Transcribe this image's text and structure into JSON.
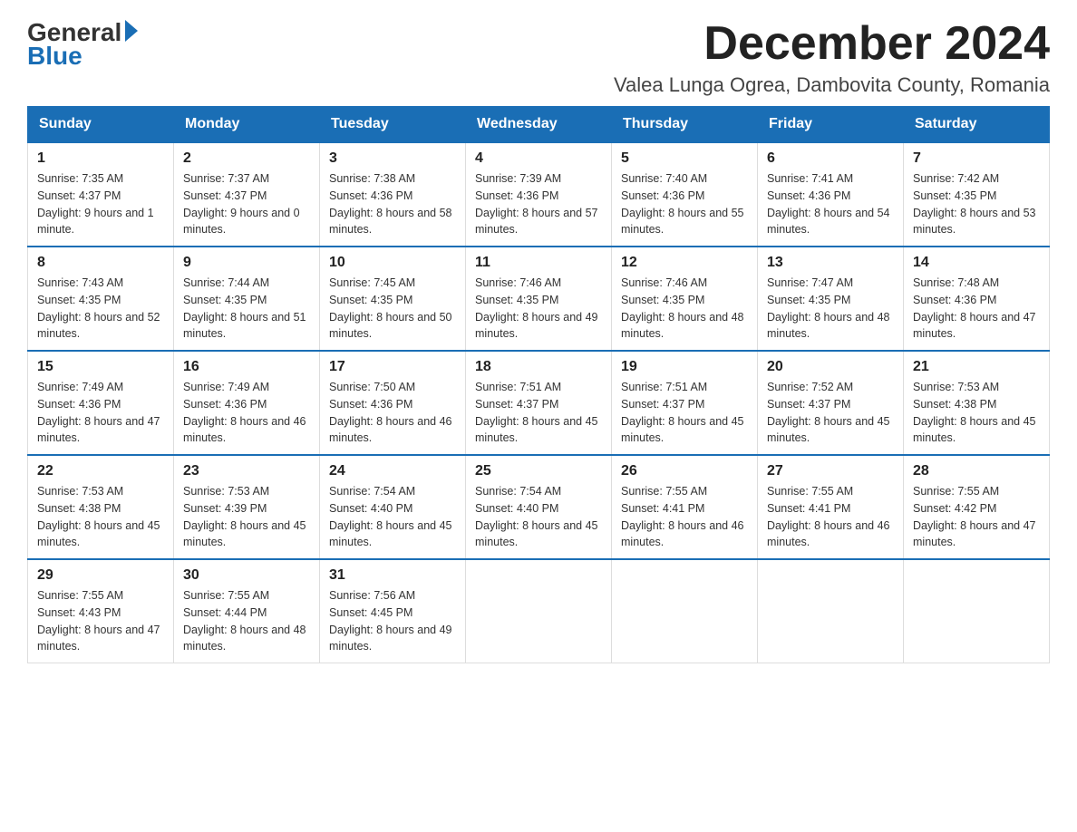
{
  "logo": {
    "general": "General",
    "blue": "Blue"
  },
  "title": "December 2024",
  "location": "Valea Lunga Ogrea, Dambovita County, Romania",
  "days_of_week": [
    "Sunday",
    "Monday",
    "Tuesday",
    "Wednesday",
    "Thursday",
    "Friday",
    "Saturday"
  ],
  "weeks": [
    [
      {
        "day": 1,
        "sunrise": "7:35 AM",
        "sunset": "4:37 PM",
        "daylight": "9 hours and 1 minute."
      },
      {
        "day": 2,
        "sunrise": "7:37 AM",
        "sunset": "4:37 PM",
        "daylight": "9 hours and 0 minutes."
      },
      {
        "day": 3,
        "sunrise": "7:38 AM",
        "sunset": "4:36 PM",
        "daylight": "8 hours and 58 minutes."
      },
      {
        "day": 4,
        "sunrise": "7:39 AM",
        "sunset": "4:36 PM",
        "daylight": "8 hours and 57 minutes."
      },
      {
        "day": 5,
        "sunrise": "7:40 AM",
        "sunset": "4:36 PM",
        "daylight": "8 hours and 55 minutes."
      },
      {
        "day": 6,
        "sunrise": "7:41 AM",
        "sunset": "4:36 PM",
        "daylight": "8 hours and 54 minutes."
      },
      {
        "day": 7,
        "sunrise": "7:42 AM",
        "sunset": "4:35 PM",
        "daylight": "8 hours and 53 minutes."
      }
    ],
    [
      {
        "day": 8,
        "sunrise": "7:43 AM",
        "sunset": "4:35 PM",
        "daylight": "8 hours and 52 minutes."
      },
      {
        "day": 9,
        "sunrise": "7:44 AM",
        "sunset": "4:35 PM",
        "daylight": "8 hours and 51 minutes."
      },
      {
        "day": 10,
        "sunrise": "7:45 AM",
        "sunset": "4:35 PM",
        "daylight": "8 hours and 50 minutes."
      },
      {
        "day": 11,
        "sunrise": "7:46 AM",
        "sunset": "4:35 PM",
        "daylight": "8 hours and 49 minutes."
      },
      {
        "day": 12,
        "sunrise": "7:46 AM",
        "sunset": "4:35 PM",
        "daylight": "8 hours and 48 minutes."
      },
      {
        "day": 13,
        "sunrise": "7:47 AM",
        "sunset": "4:35 PM",
        "daylight": "8 hours and 48 minutes."
      },
      {
        "day": 14,
        "sunrise": "7:48 AM",
        "sunset": "4:36 PM",
        "daylight": "8 hours and 47 minutes."
      }
    ],
    [
      {
        "day": 15,
        "sunrise": "7:49 AM",
        "sunset": "4:36 PM",
        "daylight": "8 hours and 47 minutes."
      },
      {
        "day": 16,
        "sunrise": "7:49 AM",
        "sunset": "4:36 PM",
        "daylight": "8 hours and 46 minutes."
      },
      {
        "day": 17,
        "sunrise": "7:50 AM",
        "sunset": "4:36 PM",
        "daylight": "8 hours and 46 minutes."
      },
      {
        "day": 18,
        "sunrise": "7:51 AM",
        "sunset": "4:37 PM",
        "daylight": "8 hours and 45 minutes."
      },
      {
        "day": 19,
        "sunrise": "7:51 AM",
        "sunset": "4:37 PM",
        "daylight": "8 hours and 45 minutes."
      },
      {
        "day": 20,
        "sunrise": "7:52 AM",
        "sunset": "4:37 PM",
        "daylight": "8 hours and 45 minutes."
      },
      {
        "day": 21,
        "sunrise": "7:53 AM",
        "sunset": "4:38 PM",
        "daylight": "8 hours and 45 minutes."
      }
    ],
    [
      {
        "day": 22,
        "sunrise": "7:53 AM",
        "sunset": "4:38 PM",
        "daylight": "8 hours and 45 minutes."
      },
      {
        "day": 23,
        "sunrise": "7:53 AM",
        "sunset": "4:39 PM",
        "daylight": "8 hours and 45 minutes."
      },
      {
        "day": 24,
        "sunrise": "7:54 AM",
        "sunset": "4:40 PM",
        "daylight": "8 hours and 45 minutes."
      },
      {
        "day": 25,
        "sunrise": "7:54 AM",
        "sunset": "4:40 PM",
        "daylight": "8 hours and 45 minutes."
      },
      {
        "day": 26,
        "sunrise": "7:55 AM",
        "sunset": "4:41 PM",
        "daylight": "8 hours and 46 minutes."
      },
      {
        "day": 27,
        "sunrise": "7:55 AM",
        "sunset": "4:41 PM",
        "daylight": "8 hours and 46 minutes."
      },
      {
        "day": 28,
        "sunrise": "7:55 AM",
        "sunset": "4:42 PM",
        "daylight": "8 hours and 47 minutes."
      }
    ],
    [
      {
        "day": 29,
        "sunrise": "7:55 AM",
        "sunset": "4:43 PM",
        "daylight": "8 hours and 47 minutes."
      },
      {
        "day": 30,
        "sunrise": "7:55 AM",
        "sunset": "4:44 PM",
        "daylight": "8 hours and 48 minutes."
      },
      {
        "day": 31,
        "sunrise": "7:56 AM",
        "sunset": "4:45 PM",
        "daylight": "8 hours and 49 minutes."
      },
      null,
      null,
      null,
      null
    ]
  ]
}
